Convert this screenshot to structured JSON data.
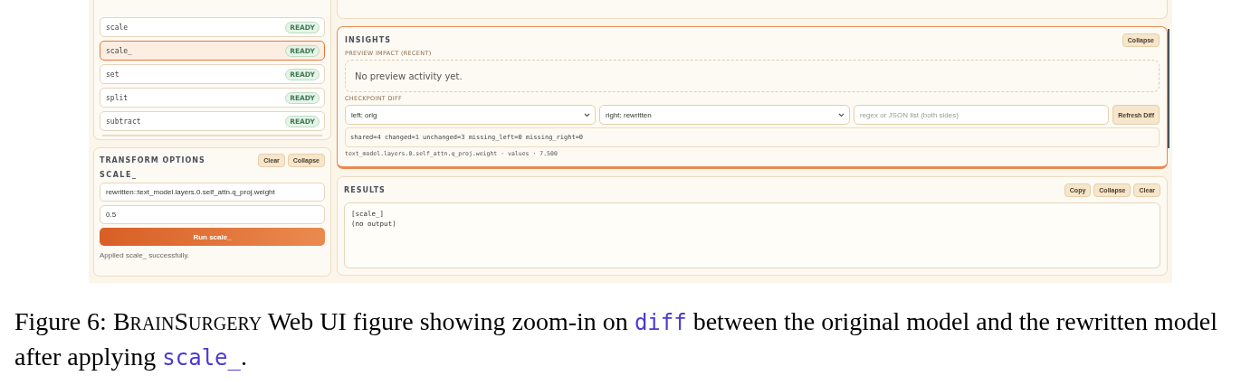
{
  "operations": {
    "items": [
      {
        "name": "scale",
        "status": "READY",
        "selected": false
      },
      {
        "name": "scale_",
        "status": "READY",
        "selected": true
      },
      {
        "name": "set",
        "status": "READY",
        "selected": false
      },
      {
        "name": "split",
        "status": "READY",
        "selected": false
      },
      {
        "name": "subtract",
        "status": "READY",
        "selected": false
      }
    ]
  },
  "transform_options": {
    "title": "TRANSFORM OPTIONS",
    "buttons": [
      "Clear",
      "Collapse"
    ],
    "operation": "SCALE_",
    "target_value": "rewritten::text_model.layers.0.self_attn.q_proj.weight",
    "factor_value": "0.5",
    "run_button": "Run scale_",
    "message": "Applied scale_ successfully."
  },
  "insights": {
    "title": "INSIGHTS",
    "collapse_button": "Collapse",
    "preview_label": "PREVIEW IMPACT (RECENT)",
    "preview_empty": "No preview activity yet.",
    "diff_label": "CHECKPOINT DIFF",
    "left_select": "left: orig",
    "right_select": "right: rewritten",
    "filter_placeholder": "regex or JSON list (both sides)",
    "refresh_button": "Refresh Diff",
    "summary": "shared=4 changed=1 unchanged=3 missing_left=0 missing_right=0",
    "detail": "text_model.layers.0.self_attn.q_proj.weight · values · 7.500"
  },
  "results": {
    "title": "RESULTS",
    "buttons": [
      "Copy",
      "Collapse",
      "Clear"
    ],
    "output_lines": [
      "[scale_]",
      "(no output)"
    ]
  },
  "caption": {
    "segments": [
      {
        "kind": "text",
        "text": "Figure 6: "
      },
      {
        "kind": "smallcaps",
        "text": "BrainSurgery"
      },
      {
        "kind": "text",
        "text": " Web UI figure showing zoom-in on "
      },
      {
        "kind": "code",
        "text": "diff"
      },
      {
        "kind": "text",
        "text": " between the original model and the rewritten model after applying "
      },
      {
        "kind": "code",
        "text": "scale_"
      },
      {
        "kind": "text",
        "text": "."
      }
    ]
  }
}
